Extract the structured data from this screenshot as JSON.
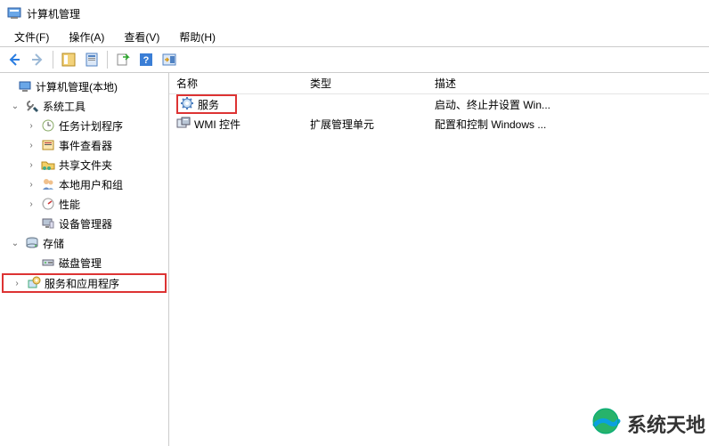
{
  "window": {
    "title": "计算机管理"
  },
  "menubar": {
    "file": "文件(F)",
    "action": "操作(A)",
    "view": "查看(V)",
    "help": "帮助(H)"
  },
  "tree": {
    "root": "计算机管理(本地)",
    "system_tools": "系统工具",
    "children_system": {
      "task_scheduler": "任务计划程序",
      "event_viewer": "事件查看器",
      "shared_folders": "共享文件夹",
      "local_users": "本地用户和组",
      "performance": "性能",
      "device_manager": "设备管理器"
    },
    "storage": "存储",
    "children_storage": {
      "disk_management": "磁盘管理"
    },
    "services_apps": "服务和应用程序"
  },
  "list": {
    "headers": {
      "name": "名称",
      "type": "类型",
      "desc": "描述"
    },
    "rows": [
      {
        "name": "服务",
        "type": "",
        "desc": "启动、终止并设置 Win...",
        "icon": "gear"
      },
      {
        "name": "WMI 控件",
        "type": "扩展管理单元",
        "desc": "配置和控制 Windows ...",
        "icon": "wmi"
      }
    ]
  },
  "watermark": "系统天地"
}
